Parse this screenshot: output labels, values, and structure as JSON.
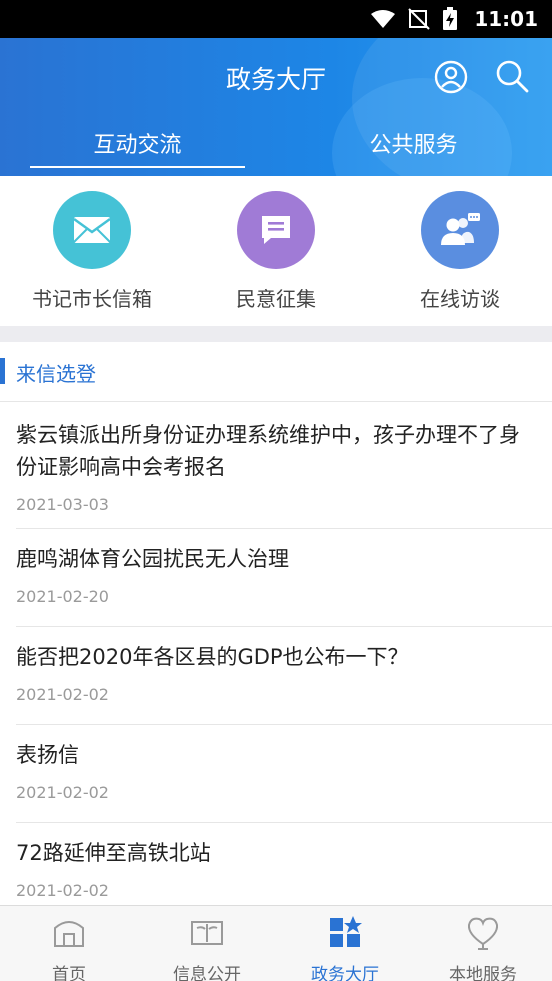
{
  "status_bar": {
    "time": "11:01"
  },
  "header": {
    "title": "政务大厅"
  },
  "tabs": [
    {
      "label": "互动交流"
    },
    {
      "label": "公共服务"
    }
  ],
  "quick_services": [
    {
      "label": "书记市长信箱",
      "icon": "envelope-icon",
      "color": "#45c2d6"
    },
    {
      "label": "民意征集",
      "icon": "message-icon",
      "color": "#a07bd6"
    },
    {
      "label": "在线访谈",
      "icon": "people-chat-icon",
      "color": "#5a8ee0"
    }
  ],
  "section": {
    "title": "来信选登"
  },
  "letters": [
    {
      "title": "紫云镇派出所身份证办理系统维护中，孩子办理不了身份证影响高中会考报名",
      "date": "2021-03-03"
    },
    {
      "title": "鹿鸣湖体育公园扰民无人治理",
      "date": "2021-02-20"
    },
    {
      "title": "能否把2020年各区县的GDP也公布一下？",
      "date": "2021-02-02"
    },
    {
      "title": "表扬信",
      "date": "2021-02-02"
    },
    {
      "title": "72路延伸至高铁北站",
      "date": "2021-02-02"
    }
  ],
  "bottom_nav": [
    {
      "label": "首页",
      "icon": "home-icon"
    },
    {
      "label": "信息公开",
      "icon": "book-icon"
    },
    {
      "label": "政务大厅",
      "icon": "grid-star-icon",
      "active": true
    },
    {
      "label": "本地服务",
      "icon": "heart-icon"
    }
  ],
  "colors": {
    "primary": "#2a73d3",
    "header_bg": "#1d86e6"
  }
}
